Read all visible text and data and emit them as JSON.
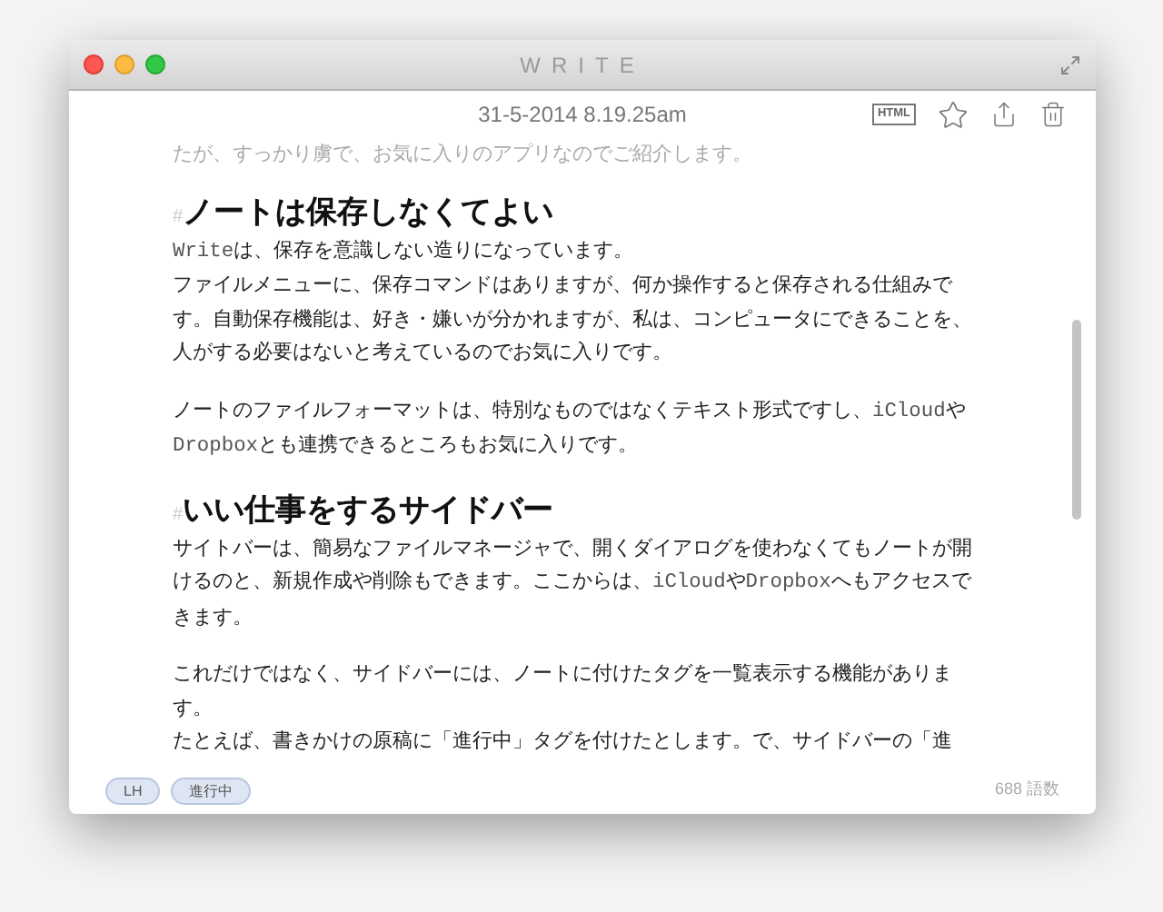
{
  "window": {
    "title": "WRITE"
  },
  "header": {
    "date": "31-5-2014 8.19.25am",
    "html_badge": "HTML"
  },
  "document": [
    {
      "kind": "faded",
      "lines": [
        [
          {
            "kind": "text",
            "text": "たが、すっかり虜で、お気に入りのアプリなのでご紹介します。"
          }
        ]
      ]
    },
    {
      "kind": "heading",
      "marker": "#",
      "text": "ノートは保存しなくてよい"
    },
    {
      "kind": "paragraph",
      "lines": [
        [
          {
            "kind": "code",
            "text": "Write"
          },
          {
            "kind": "text",
            "text": "は、保存を意識しない造りになっています。"
          }
        ],
        [
          {
            "kind": "text",
            "text": "ファイルメニューに、保存コマンドはありますが、何か操作すると保存される仕組みです。自動保存機能は、好き・嫌いが分かれますが、私は、コンピュータにできることを、人がする必要はないと考えているのでお気に入りです。"
          }
        ]
      ]
    },
    {
      "kind": "paragraph",
      "lines": [
        [
          {
            "kind": "text",
            "text": "ノートのファイルフォーマットは、特別なものではなくテキスト形式ですし、"
          },
          {
            "kind": "code",
            "text": "iCloud"
          },
          {
            "kind": "text",
            "text": "や"
          },
          {
            "kind": "code",
            "text": "Dropbox"
          },
          {
            "kind": "text",
            "text": "とも連携できるところもお気に入りです。"
          }
        ]
      ]
    },
    {
      "kind": "heading",
      "marker": "#",
      "text": "いい仕事をするサイドバー"
    },
    {
      "kind": "paragraph",
      "lines": [
        [
          {
            "kind": "text",
            "text": "サイトバーは、簡易なファイルマネージャで、開くダイアログを使わなくてもノートが開けるのと、新規作成や削除もできます。ここからは、"
          },
          {
            "kind": "code",
            "text": "iCloud"
          },
          {
            "kind": "text",
            "text": "や"
          },
          {
            "kind": "code",
            "text": "Dropbox"
          },
          {
            "kind": "text",
            "text": "へもアクセスできます。"
          }
        ]
      ]
    },
    {
      "kind": "paragraph",
      "lines": [
        [
          {
            "kind": "text",
            "text": "これだけではなく、サイドバーには、ノートに付けたタグを一覧表示する機能があります。"
          }
        ],
        [
          {
            "kind": "text",
            "text": "たとえば、書きかけの原稿に「進行中」タグを付けたとします。で、サイドバーの「進"
          }
        ]
      ]
    }
  ],
  "footer": {
    "tags": [
      "LH",
      "進行中"
    ],
    "word_count": "688 語数"
  }
}
